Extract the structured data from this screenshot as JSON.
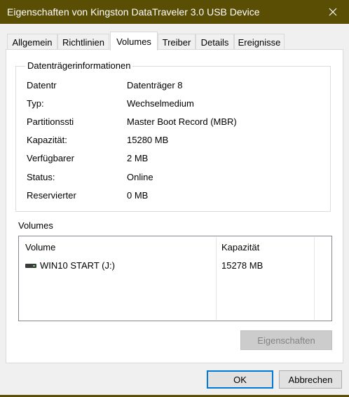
{
  "window": {
    "title": "Eigenschaften von Kingston DataTraveler 3.0 USB Device",
    "accent_color": "#5a4e05"
  },
  "tabs": [
    {
      "label": "Allgemein"
    },
    {
      "label": "Richtlinien"
    },
    {
      "label": "Volumes",
      "active": true
    },
    {
      "label": "Treiber"
    },
    {
      "label": "Details"
    },
    {
      "label": "Ereignisse"
    }
  ],
  "disk_info": {
    "group_title": "Datenträgerinformationen",
    "rows": [
      {
        "label": "Datentr",
        "value": "Datenträger 8"
      },
      {
        "label": "Typ:",
        "value": "Wechselmedium"
      },
      {
        "label": "Partitionssti",
        "value": "Master Boot Record (MBR)"
      },
      {
        "label": "Kapazität:",
        "value": "15280 MB"
      },
      {
        "label": "Verfügbarer",
        "value": "2 MB"
      },
      {
        "label": "Status:",
        "value": "Online"
      },
      {
        "label": "Reservierter",
        "value": "0 MB"
      }
    ]
  },
  "volumes": {
    "title": "Volumes",
    "columns": [
      "Volume",
      "Kapazität"
    ],
    "rows": [
      {
        "volume": "WIN10 START (J:)",
        "capacity": "15278 MB",
        "icon": "usb-drive-icon"
      }
    ],
    "properties_button": "Eigenschaften"
  },
  "footer": {
    "ok_label": "OK",
    "cancel_label": "Abbrechen"
  }
}
